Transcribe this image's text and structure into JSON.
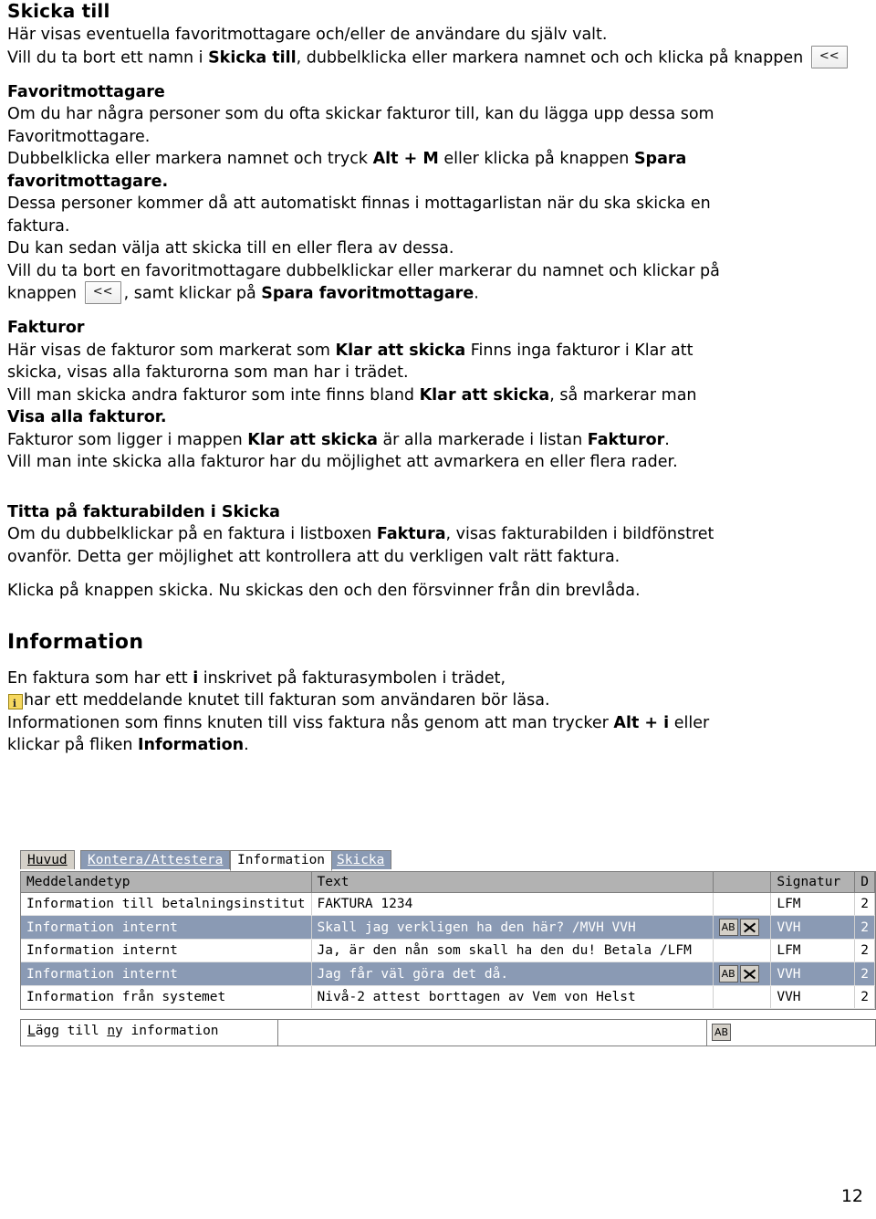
{
  "document": {
    "sections": {
      "skicka_till": {
        "title": "Skicka till",
        "p1": "Här visas eventuella favoritmottagare och/eller de användare du själv valt.",
        "p2_a": "Vill du ta bort ett namn i ",
        "p2_b": "Skicka till",
        "p2_c": ", dubbelklicka eller markera namnet och och klicka på knappen",
        "button_label": "<<"
      },
      "favoritmottagare": {
        "heading": "Favoritmottagare",
        "l1": "Om du har några personer som du ofta skickar fakturor till, kan du lägga upp dessa som",
        "l2": "Favoritmottagare.",
        "l3_a": "Dubbelklicka eller markera namnet och tryck ",
        "l3_b": "Alt + M",
        "l3_c": " eller klicka på knappen ",
        "l3_d": "Spara",
        "l4_b": "favoritmottagare.",
        "l5": "Dessa personer kommer då att automatiskt finnas i mottagarlistan när du ska skicka en",
        "l6": "faktura.",
        "l7": "Du kan sedan välja att skicka till en eller flera av dessa.",
        "l8": "Vill du ta bort en favoritmottagare dubbelklickar eller markerar du namnet och klickar på",
        "l9_a": "knappen",
        "button_label": "<<",
        "l9_b": ", samt klickar på ",
        "l9_c": "Spara favoritmottagare",
        "l9_d": "."
      },
      "fakturor": {
        "heading": "Fakturor",
        "l1_a": "Här visas de fakturor som markerat som ",
        "l1_b": "Klar att skicka",
        "l1_c": " Finns inga fakturor i Klar att",
        "l2": "skicka, visas alla fakturorna som man har i trädet.",
        "l3_a": "Vill man skicka andra fakturor som inte finns bland ",
        "l3_b": "Klar att skicka",
        "l3_c": ", så markerar man",
        "l4_b": "Visa alla fakturor.",
        "l5_a": "Fakturor som ligger i mappen ",
        "l5_b": "Klar att skicka",
        "l5_c": " är alla markerade i listan ",
        "l5_d": "Fakturor",
        "l5_e": ".",
        "l6": "Vill man inte skicka alla fakturor har du möjlighet att avmarkera en eller flera rader."
      },
      "titta": {
        "heading": "Titta på fakturabilden i Skicka",
        "l1_a": "Om du dubbelklickar på en faktura i listboxen ",
        "l1_b": "Faktura",
        "l1_c": ", visas fakturabilden i bildfönstret",
        "l2": "ovanför. Detta ger möjlighet att kontrollera att du verkligen valt rätt faktura.",
        "l3": "Klicka på knappen skicka. Nu skickas den och den försvinner från din brevlåda."
      },
      "information": {
        "heading": "Information",
        "l1_a": "En faktura som har ett ",
        "l1_b": "i",
        "l1_c": " inskrivet på fakturasymbolen i trädet,",
        "l2": "har ett meddelande knutet till fakturan som användaren bör läsa.",
        "l3_a": "Informationen som finns knuten till viss faktura nås genom att man trycker ",
        "l3_b": "Alt + i",
        "l3_c": " eller",
        "l4_a": "klickar på fliken ",
        "l4_b": "Information",
        "l4_c": ".",
        "icon_name": "info-note-icon"
      }
    },
    "page_number": "12"
  },
  "screenshot": {
    "tabs": [
      {
        "label": "Huvud",
        "state": "inactive"
      },
      {
        "label": "Kontera/Attestera",
        "state": "selected"
      },
      {
        "label": "Information",
        "state": "active"
      },
      {
        "label": "Skicka",
        "state": "selected"
      }
    ],
    "grid": {
      "headers": [
        "Meddelandetyp",
        "Text",
        "",
        "Signatur",
        "D"
      ],
      "rows": [
        {
          "type": "Information till betalningsinstitut",
          "text": "FAKTURA 1234",
          "icons": [],
          "signature": "LFM",
          "d": "2",
          "highlighted": false
        },
        {
          "type": "Information internt",
          "text": "Skall jag verkligen ha den här? /MVH VVH",
          "icons": [
            "AB",
            "X"
          ],
          "signature": "VVH",
          "d": "2",
          "highlighted": true
        },
        {
          "type": "Information internt",
          "text": "Ja, är den nån som skall ha den du! Betala /LFM",
          "icons": [],
          "signature": "LFM",
          "d": "2",
          "highlighted": false
        },
        {
          "type": "Information internt",
          "text": "Jag får väl göra det då.",
          "icons": [
            "AB",
            "X"
          ],
          "signature": "VVH",
          "d": "2",
          "highlighted": true
        },
        {
          "type": "Information från systemet",
          "text": "Nivå-2 attest borttagen av Vem von Helst",
          "icons": [],
          "signature": "VVH",
          "d": "2",
          "highlighted": false
        }
      ]
    },
    "add_row": {
      "label_1": "L",
      "label_2": "ägg till ",
      "label_3": "n",
      "label_4": "y information",
      "button": "AB"
    }
  }
}
